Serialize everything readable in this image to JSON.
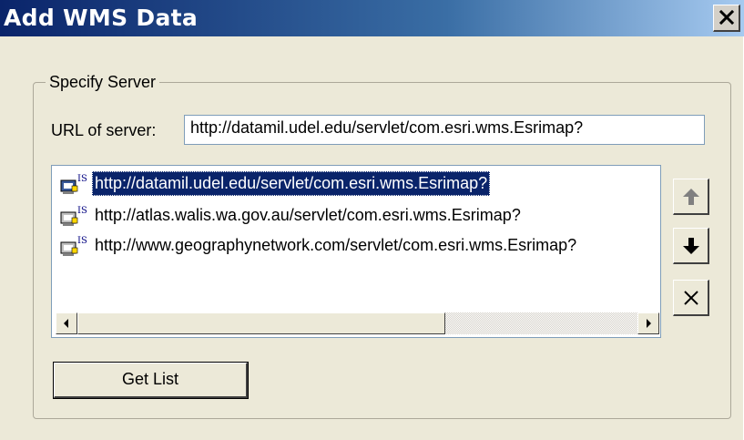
{
  "window": {
    "title": "Add WMS Data"
  },
  "group": {
    "label": "Specify Server"
  },
  "url_field": {
    "label": "URL of server:",
    "value": "http://datamil.udel.edu/servlet/com.esri.wms.Esrimap?"
  },
  "servers": [
    {
      "url": "http://datamil.udel.edu/servlet/com.esri.wms.Esrimap?",
      "selected": true,
      "icon": "wms-server-icon"
    },
    {
      "url": "http://atlas.walis.wa.gov.au/servlet/com.esri.wms.Esrimap?",
      "selected": false,
      "icon": "wms-server-icon"
    },
    {
      "url": "http://www.geographynetwork.com/servlet/com.esri.wms.Esrimap?",
      "selected": false,
      "icon": "wms-server-icon"
    }
  ],
  "buttons": {
    "get_list": "Get List",
    "move_up_icon": "arrow-up-icon",
    "move_down_icon": "arrow-down-icon",
    "delete_icon": "delete-x-icon"
  },
  "colors": {
    "title_gradient_start": "#0a246a",
    "selection": "#0a246a",
    "face": "#ece9d8"
  }
}
